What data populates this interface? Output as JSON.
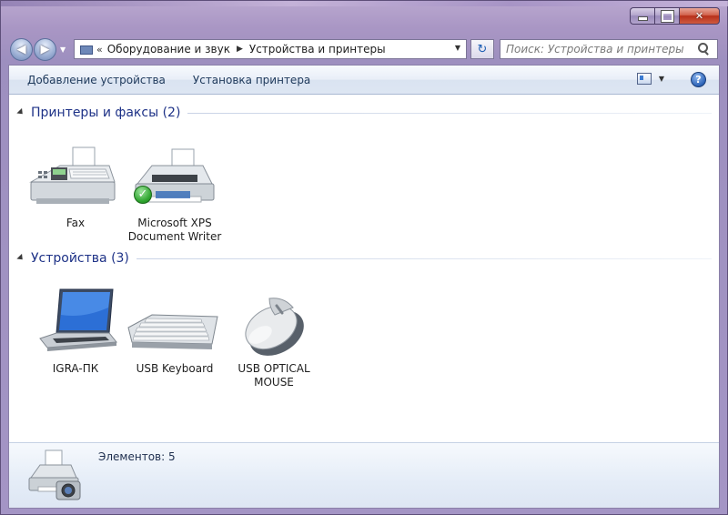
{
  "window": {
    "close_glyph": "✕"
  },
  "navigation": {
    "back_glyph": "◀",
    "forward_glyph": "▶",
    "address": {
      "chevron": "«",
      "crumbs": [
        "Оборудование и звук",
        "Устройства и принтеры"
      ],
      "separator": "▶"
    },
    "refresh_glyph": "↻",
    "search": {
      "placeholder": "Поиск: Устройства и принтеры"
    }
  },
  "toolbar": {
    "add_device": "Добавление устройства",
    "add_printer": "Установка принтера",
    "help_glyph": "?"
  },
  "groups": {
    "printers": {
      "title": "Принтеры и факсы (2)",
      "items": [
        {
          "label_line1": "Fax",
          "label_line2": ""
        },
        {
          "label_line1": "Microsoft XPS",
          "label_line2": "Document Writer",
          "default_badge": "✓"
        }
      ]
    },
    "devices": {
      "title": "Устройства (3)",
      "items": [
        {
          "label_line1": "IGRA-ПК",
          "label_line2": ""
        },
        {
          "label_line1": "USB Keyboard",
          "label_line2": ""
        },
        {
          "label_line1": "USB OPTICAL",
          "label_line2": "MOUSE"
        }
      ]
    }
  },
  "details": {
    "count_text": "Элементов: 5"
  },
  "colors": {
    "accent": "#1e3287",
    "frame": "#a996c4",
    "toolbar": "#dae3f1",
    "default_check": "#2fa52f"
  }
}
